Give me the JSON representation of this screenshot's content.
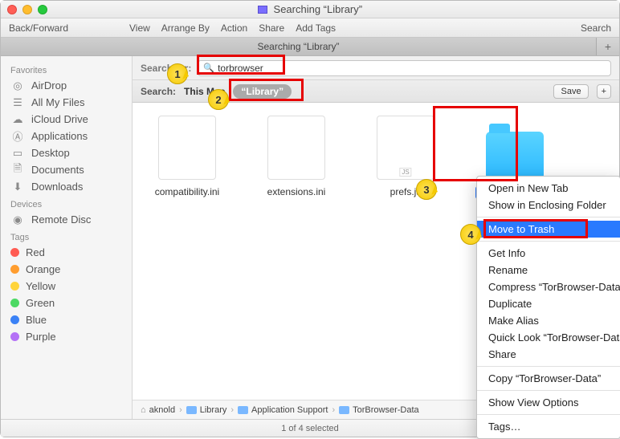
{
  "window": {
    "title": "Searching “Library”"
  },
  "toolbar": {
    "back_forward": "Back/Forward",
    "menus": [
      "View",
      "Arrange By",
      "Action",
      "Share",
      "Add Tags"
    ],
    "search": "Search"
  },
  "tabbar": {
    "active_tab": "Searching “Library”",
    "plus": "+"
  },
  "sidebar": {
    "favorites_head": "Favorites",
    "favorites": [
      {
        "icon": "airdrop-icon",
        "label": "AirDrop"
      },
      {
        "icon": "all-my-files-icon",
        "label": "All My Files"
      },
      {
        "icon": "icloud-icon",
        "label": "iCloud Drive"
      },
      {
        "icon": "applications-icon",
        "label": "Applications"
      },
      {
        "icon": "desktop-icon",
        "label": "Desktop"
      },
      {
        "icon": "documents-icon",
        "label": "Documents"
      },
      {
        "icon": "downloads-icon",
        "label": "Downloads"
      }
    ],
    "devices_head": "Devices",
    "devices": [
      {
        "icon": "remote-disc-icon",
        "label": "Remote Disc"
      }
    ],
    "tags_head": "Tags",
    "tags": [
      {
        "color": "#ff5b52",
        "label": "Red"
      },
      {
        "color": "#ff9d2f",
        "label": "Orange"
      },
      {
        "color": "#ffd43b",
        "label": "Yellow"
      },
      {
        "color": "#4cd964",
        "label": "Green"
      },
      {
        "color": "#3b82f6",
        "label": "Blue"
      },
      {
        "color": "#b471f6",
        "label": "Purple"
      }
    ]
  },
  "search": {
    "label": "Search for:",
    "value": "torbrowser",
    "scope_label": "Search:",
    "scope_mac": "This Mac",
    "scope_library": "“Library”",
    "save": "Save",
    "plus": "+"
  },
  "files": [
    {
      "name": "compatibility.ini",
      "kind": "doc"
    },
    {
      "name": "extensions.ini",
      "kind": "doc"
    },
    {
      "name": "prefs.js",
      "kind": "js"
    },
    {
      "name": "TorBrowser-Data",
      "kind": "folder",
      "selected": true
    }
  ],
  "path": [
    "aknold",
    "Library",
    "Application Support",
    "TorBrowser-Data"
  ],
  "status": "1 of 4 selected",
  "context_menu": {
    "items": [
      "Open in New Tab",
      "Show in Enclosing Folder",
      "-",
      "Move to Trash",
      "-",
      "Get Info",
      "Rename",
      "Compress “TorBrowser-Data”",
      "Duplicate",
      "Make Alias",
      "Quick Look “TorBrowser-Data”",
      "Share",
      "-",
      "Copy “TorBrowser-Data”",
      "-",
      "Show View Options",
      "-",
      "Tags…"
    ],
    "selected_index": 3
  },
  "callouts": {
    "1": "1",
    "2": "2",
    "3": "3",
    "4": "4"
  }
}
